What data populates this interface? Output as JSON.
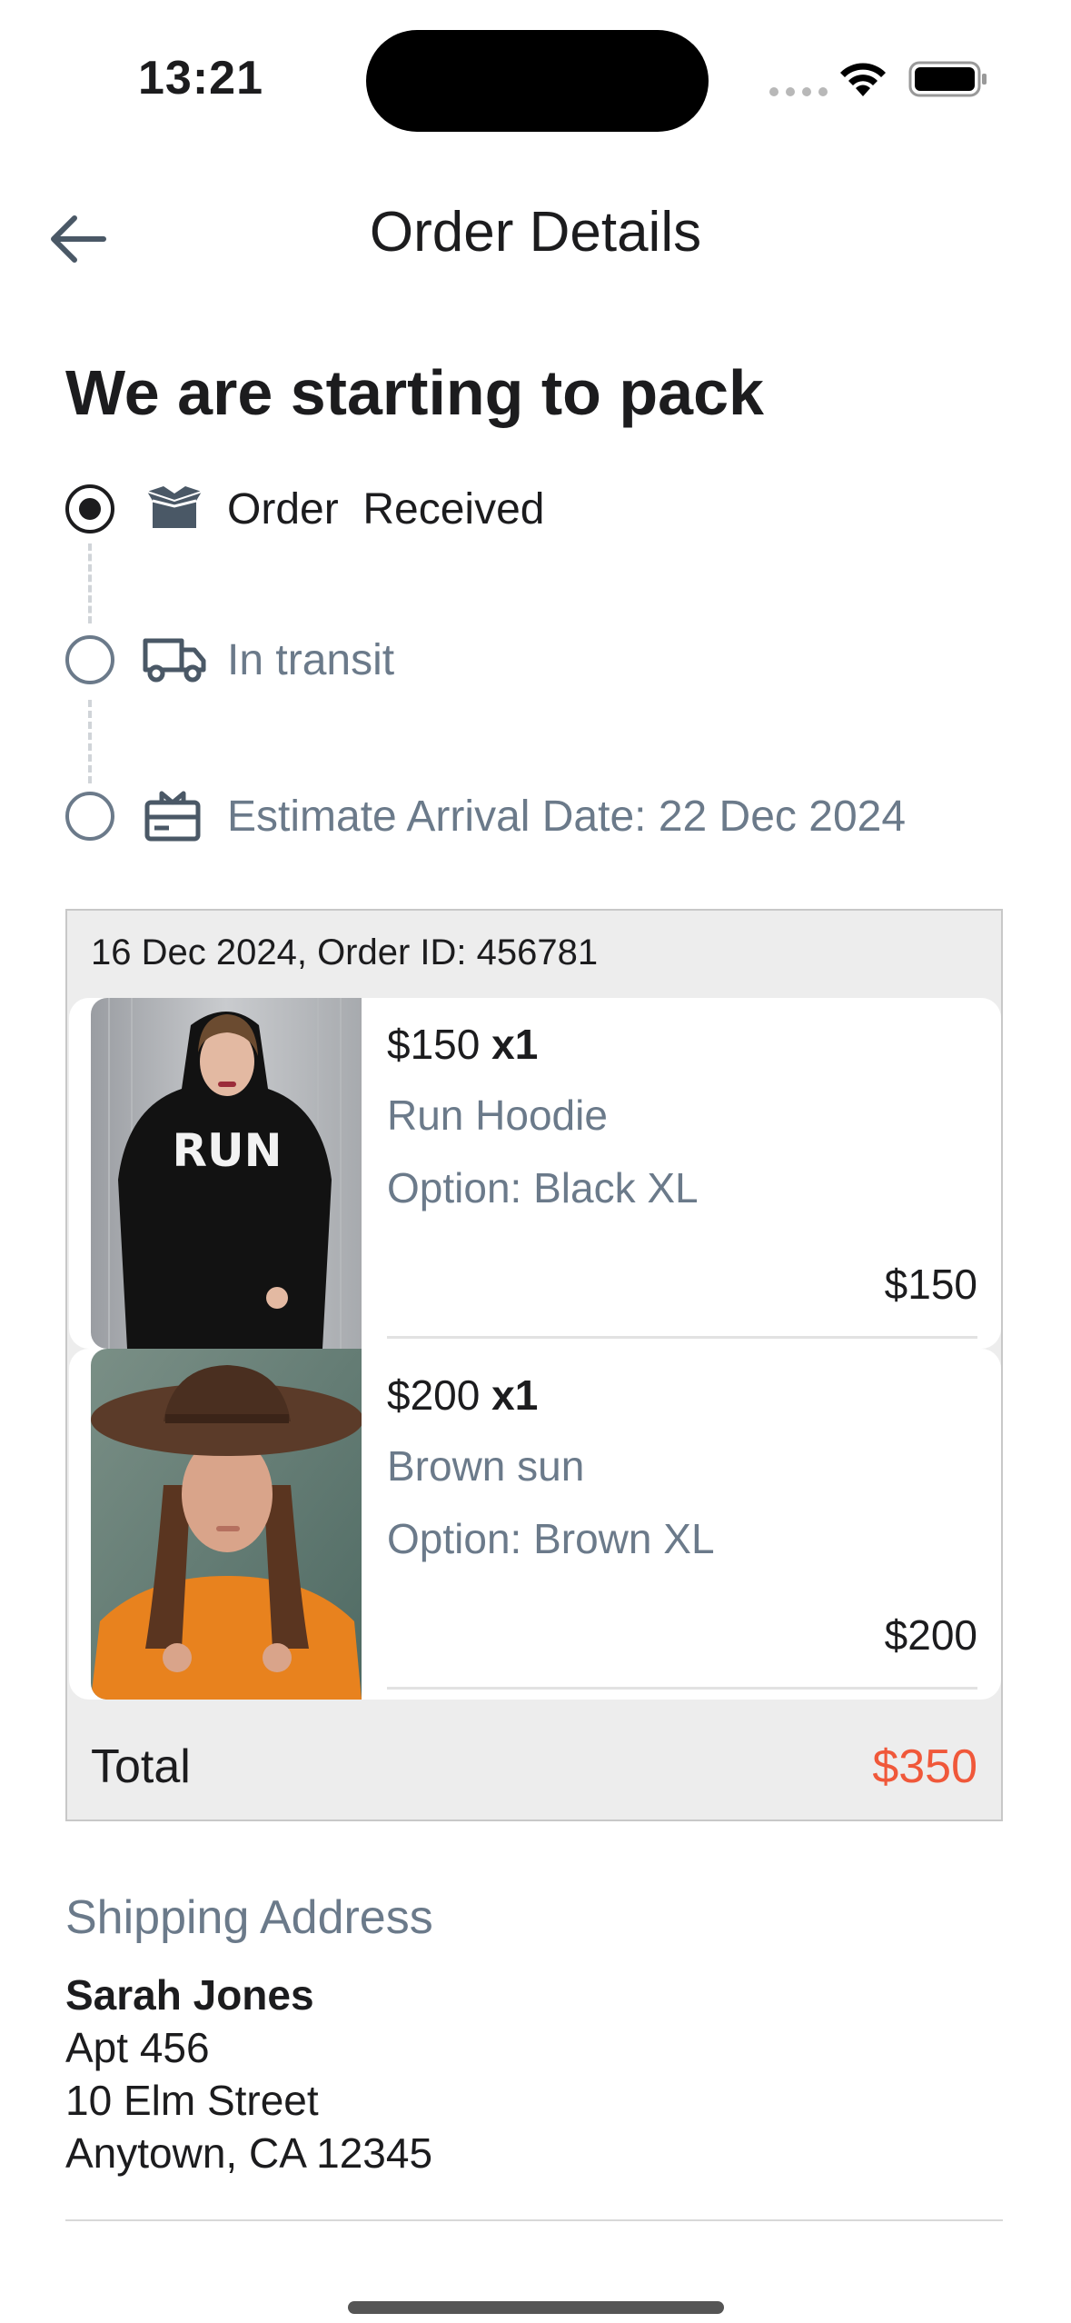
{
  "status_bar": {
    "time": "13:21"
  },
  "header": {
    "title": "Order Details"
  },
  "status": {
    "heading": "We are starting to pack",
    "steps": [
      {
        "label": "Order  Received",
        "icon": "box-icon",
        "active": true
      },
      {
        "label": "In transit",
        "icon": "truck-icon",
        "active": false
      },
      {
        "label": "Estimate Arrival Date: 22 Dec 2024",
        "icon": "gift-icon",
        "active": false
      }
    ]
  },
  "order": {
    "meta": "16 Dec 2024, Order ID: 456781",
    "items": [
      {
        "price": "$150",
        "qty": "x1",
        "name": "Run Hoodie",
        "option": "Option: Black XL",
        "line_total": "$150"
      },
      {
        "price": "$200",
        "qty": "x1",
        "name": "Brown sun",
        "option": "Option: Brown XL",
        "line_total": "$200"
      }
    ],
    "total_label": "Total",
    "total_value": "$350"
  },
  "shipping": {
    "heading": "Shipping Address",
    "name": "Sarah Jones",
    "lines": [
      "Apt 456",
      "10 Elm Street",
      "Anytown, CA 12345"
    ]
  },
  "colors": {
    "accent_total": "#f0583a",
    "muted": "#6b7a8a"
  }
}
